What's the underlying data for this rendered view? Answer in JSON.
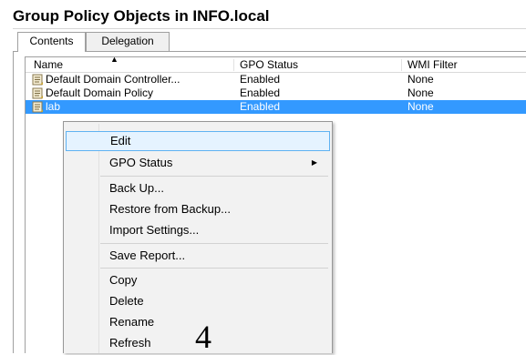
{
  "header": {
    "title": "Group Policy Objects in INFO.local"
  },
  "tabs": [
    {
      "label": "Contents",
      "active": true
    },
    {
      "label": "Delegation",
      "active": false
    }
  ],
  "table": {
    "columns": [
      "Name",
      "GPO Status",
      "WMI Filter"
    ],
    "sort_indicator": "▲",
    "rows": [
      {
        "name": "Default Domain Controller...",
        "status": "Enabled",
        "wmi": "None",
        "selected": false
      },
      {
        "name": "Default Domain Policy",
        "status": "Enabled",
        "wmi": "None",
        "selected": false
      },
      {
        "name": "lab",
        "status": "Enabled",
        "wmi": "None",
        "selected": true
      }
    ]
  },
  "context_menu": {
    "items": [
      {
        "label": "Edit",
        "highlighted": true
      },
      {
        "label": "GPO Status",
        "submenu": true,
        "submenu_glyph": "▶"
      },
      {
        "label": "Back Up..."
      },
      {
        "label": "Restore from Backup..."
      },
      {
        "label": "Import Settings..."
      },
      {
        "label": "Save Report..."
      },
      {
        "label": "Copy"
      },
      {
        "label": "Delete"
      },
      {
        "label": "Rename"
      },
      {
        "label": "Refresh"
      }
    ]
  },
  "annotation": {
    "step_number": "4"
  },
  "icons": {
    "gpo": "gpo-scroll-icon",
    "submenu": "submenu-arrow-icon",
    "sort": "sort-up-icon"
  },
  "colors": {
    "selection": "#3399ff",
    "menu_highlight_bg": "#e5f3ff",
    "menu_highlight_border": "#5fb2f2"
  }
}
